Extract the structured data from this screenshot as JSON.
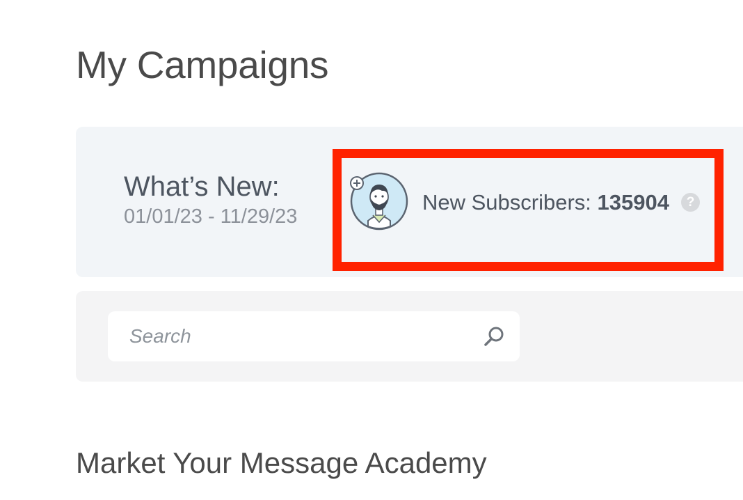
{
  "page": {
    "title": "My Campaigns"
  },
  "whats_new": {
    "heading": "What’s New:",
    "date_range": "01/01/23 - 11/29/23",
    "stat": {
      "label": "New Subscribers: ",
      "value": "135904",
      "help_glyph": "?",
      "avatar_icon": "new-subscriber-avatar-icon"
    }
  },
  "search": {
    "placeholder": "Search",
    "value": "",
    "icon": "search-icon"
  },
  "academy": {
    "title": "Market Your Message Academy"
  },
  "colors": {
    "highlight": "#ff2200",
    "panel_bg": "#f2f5f8",
    "search_panel_bg": "#f4f4f5",
    "text": "#4d5560"
  }
}
